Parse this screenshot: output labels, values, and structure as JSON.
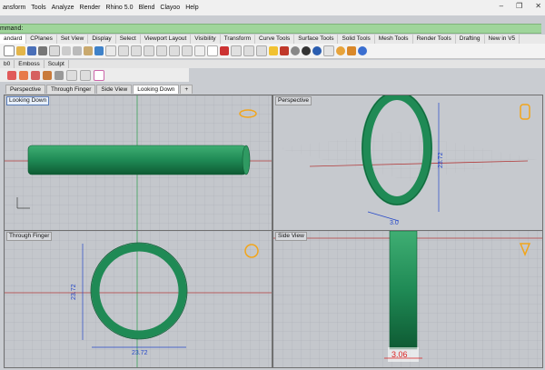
{
  "menu": [
    "ansform",
    "Tools",
    "Analyze",
    "Render",
    "Rhino 5.0",
    "Blend",
    "Clayoo",
    "Help"
  ],
  "command_prompt": "mmand:",
  "toolbar_tabs": [
    "andard",
    "CPlanes",
    "Set View",
    "Display",
    "Select",
    "Viewport Layout",
    "Visibility",
    "Transform",
    "Curve Tools",
    "Surface Tools",
    "Solid Tools",
    "Mesh Tools",
    "Render Tools",
    "Drafting",
    "New in V5"
  ],
  "plugin_tabs": [
    "b0",
    "Emboss",
    "Sculpt"
  ],
  "viewport_tabs": [
    "Perspective",
    "Through Finger",
    "Side View",
    "Looking Down"
  ],
  "active_viewport_tab": "Looking Down",
  "viewports": {
    "top_left": {
      "label": "Looking Down"
    },
    "top_right": {
      "label": "Perspective",
      "dim_height": "23.72",
      "dim_width": "3.0"
    },
    "bottom_left": {
      "label": "Through Finger",
      "dim_height": "23.72",
      "dim_width": "23.72"
    },
    "bottom_right": {
      "label": "Side View",
      "dim_width": "3.06"
    }
  },
  "colors": {
    "ring": "#1f8a55",
    "ring_dark": "#0e5a33",
    "grid": "#a8abb1",
    "axis_red": "#b23a3a",
    "axis_green": "#3aa05a",
    "dim_blue": "#2447c8",
    "gumball": "#f2a51a"
  }
}
